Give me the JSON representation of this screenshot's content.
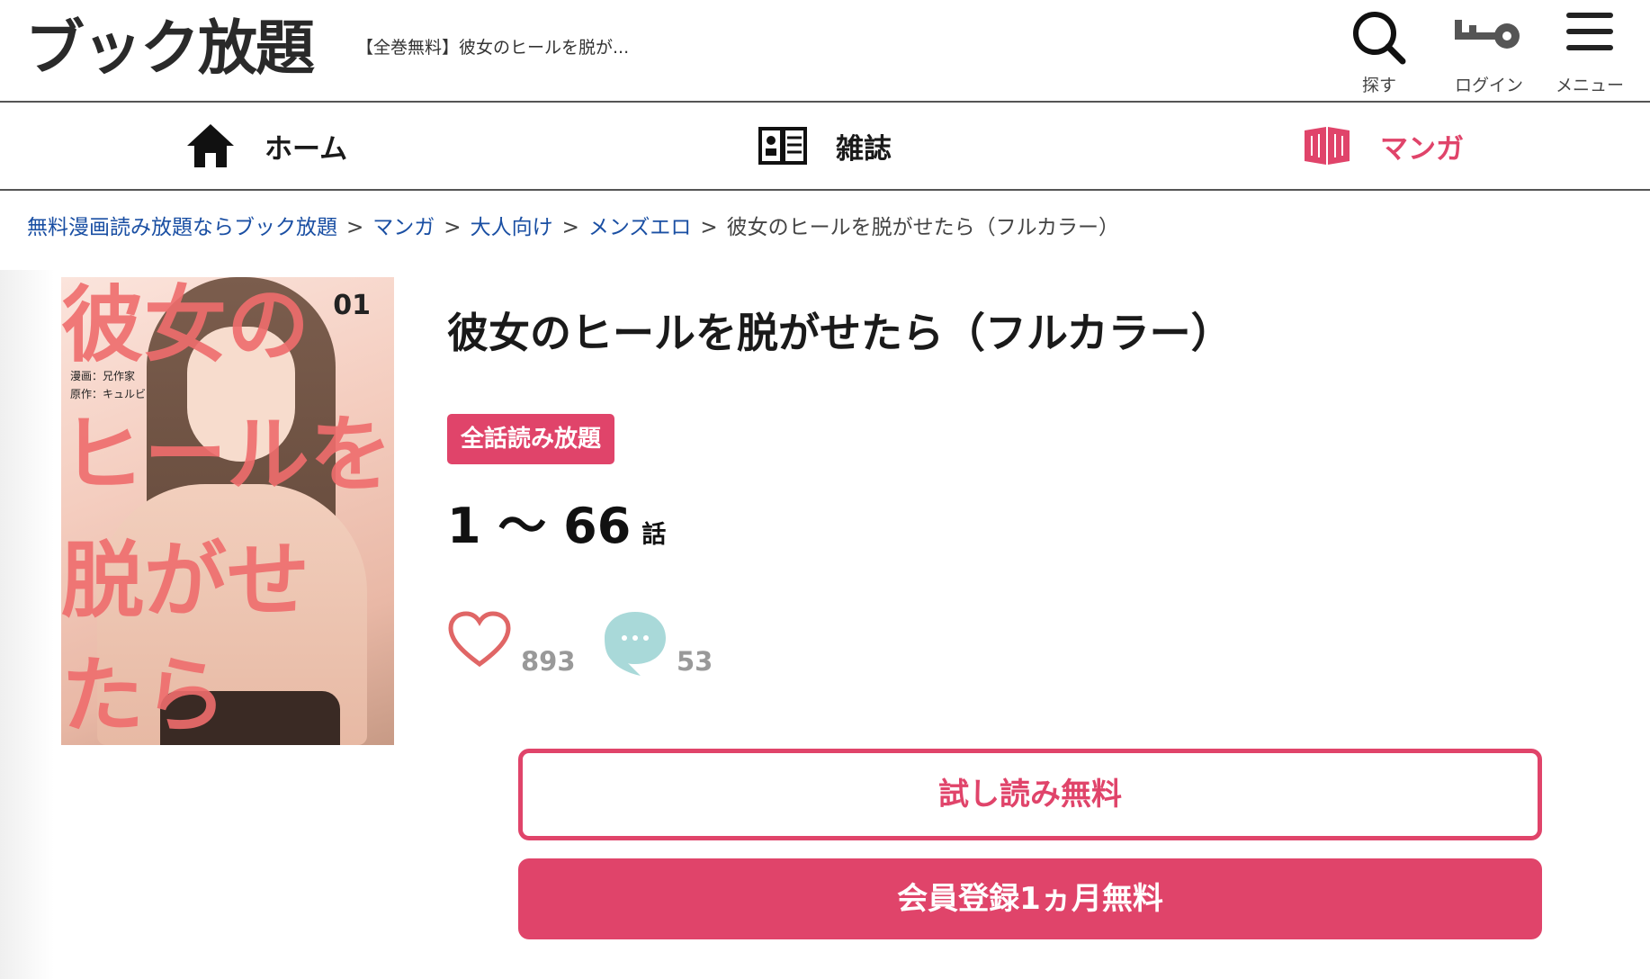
{
  "header": {
    "logo": "ブック放題",
    "page_title": "【全巻無料】彼女のヒールを脱が...",
    "search_label": "探す",
    "login_label": "ログイン",
    "menu_label": "メニュー"
  },
  "nav": {
    "home": "ホーム",
    "magazine": "雑誌",
    "manga": "マンガ",
    "active": "manga"
  },
  "breadcrumb": {
    "items": [
      "無料漫画読み放題ならブック放題",
      "マンガ",
      "大人向け",
      "メンズエロ"
    ],
    "separator": ">",
    "current": "彼女のヒールを脱がせたら（フルカラー）"
  },
  "cover": {
    "title_lines": [
      "彼女の",
      "ヒールを",
      "脱がせ",
      "たら"
    ],
    "volume": "01",
    "credits": [
      "漫画：兄作家",
      "原作：キュルビ"
    ]
  },
  "book": {
    "title": "彼女のヒールを脱がせたら（フルカラー）",
    "badge": "全話読み放題",
    "episodes": "1 〜 66",
    "episodes_unit": "話",
    "likes": "893",
    "comments": "53"
  },
  "buttons": {
    "trial": "試し読み無料",
    "signup": "会員登録1ヵ月無料"
  },
  "colors": {
    "accent": "#e0446a",
    "link": "#1a4fa3",
    "comment_bubble": "#a9d9d9"
  }
}
